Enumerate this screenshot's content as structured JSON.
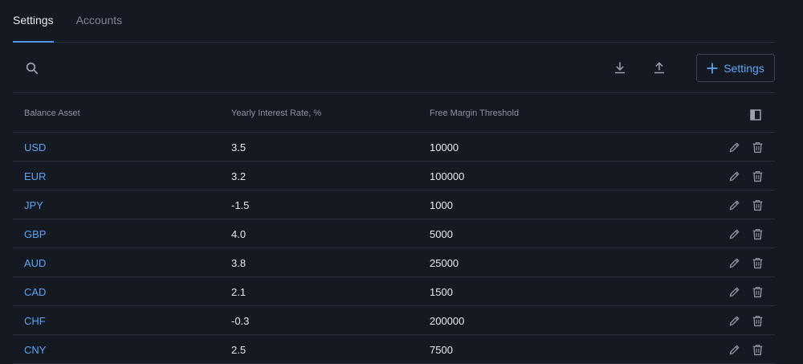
{
  "tabs": [
    {
      "label": "Settings",
      "active": true
    },
    {
      "label": "Accounts",
      "active": false
    }
  ],
  "toolbar": {
    "search_icon": "search-icon",
    "download_icon": "download-icon",
    "upload_icon": "upload-icon",
    "add_button_label": "Settings"
  },
  "table": {
    "columns": {
      "asset": "Balance Asset",
      "rate": "Yearly Interest Rate, %",
      "threshold": "Free Margin Threshold"
    },
    "rows": [
      {
        "asset": "USD",
        "rate": "3.5",
        "threshold": "10000"
      },
      {
        "asset": "EUR",
        "rate": "3.2",
        "threshold": "100000"
      },
      {
        "asset": "JPY",
        "rate": "-1.5",
        "threshold": "1000"
      },
      {
        "asset": "GBP",
        "rate": "4.0",
        "threshold": "5000"
      },
      {
        "asset": "AUD",
        "rate": "3.8",
        "threshold": "25000"
      },
      {
        "asset": "CAD",
        "rate": "2.1",
        "threshold": "1500"
      },
      {
        "asset": "CHF",
        "rate": "-0.3",
        "threshold": "200000"
      },
      {
        "asset": "CNY",
        "rate": "2.5",
        "threshold": "7500"
      }
    ]
  },
  "colors": {
    "background": "#151a22",
    "accent": "#5ea3f5",
    "border": "#2a303a",
    "muted_text": "#8a929f"
  }
}
